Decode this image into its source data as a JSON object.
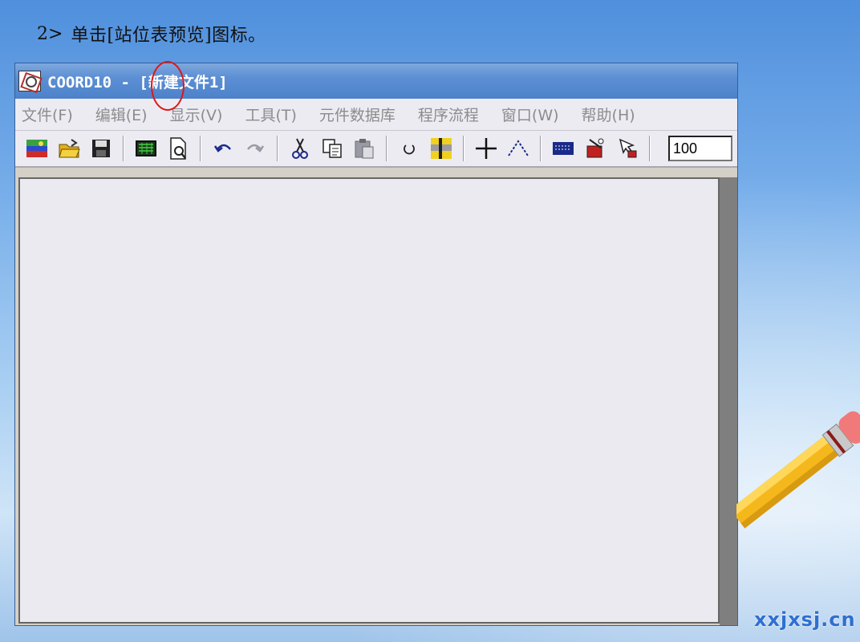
{
  "instruction": {
    "step": "2>",
    "text": "单击[站位表预览]图标。"
  },
  "window": {
    "title": "COORD10 - [新建文件1]",
    "menu": [
      "文件(F)",
      "编辑(E)",
      "显示(V)",
      "工具(T)",
      "元件数据库",
      "程序流程",
      "窗口(W)",
      "帮助(H)"
    ],
    "toolbar": {
      "zoom_value": "100",
      "icons": [
        "new-file-icon",
        "open-folder-icon",
        "save-icon",
        "station-table-icon",
        "station-table-preview-icon",
        "undo-icon",
        "redo-icon",
        "cut-icon",
        "copy-icon",
        "paste-icon",
        "rotate-icon",
        "grid-icon",
        "crosshair-icon",
        "polyline-icon",
        "keyboard-icon",
        "component-icon",
        "pointer-icon"
      ]
    }
  },
  "watermark": "xxjxsj.cn",
  "colors": {
    "highlight": "#e01616",
    "titlebar": "#5c8fd4",
    "menu_text_disabled": "#8c8c8c"
  }
}
